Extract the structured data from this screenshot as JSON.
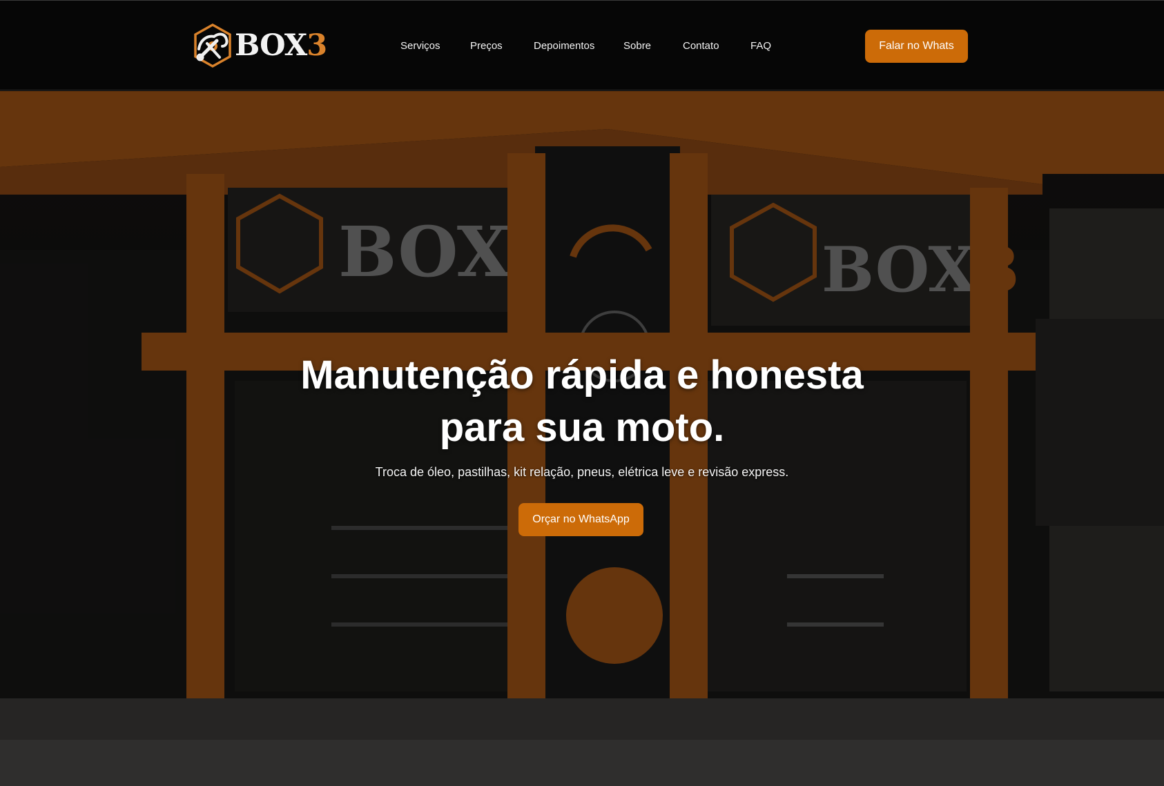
{
  "header": {
    "logo": {
      "text_main": "BOX",
      "text_accent": "3"
    },
    "nav": [
      {
        "label": "Serviços"
      },
      {
        "label": "Preços"
      },
      {
        "label": "Depoimentos"
      },
      {
        "label": "Sobre"
      },
      {
        "label": "Contato"
      },
      {
        "label": "FAQ"
      }
    ],
    "cta_label": "Falar no Whats"
  },
  "hero": {
    "title_line1": "Manutenção rápida e honesta",
    "title_line2": "para sua moto.",
    "subtitle": "Troca de óleo, pastilhas, kit relação, pneus, elétrica leve e revisão express.",
    "cta_label": "Orçar no WhatsApp",
    "background_image": "moto-shop-storefront-photo"
  },
  "colors": {
    "accent": "#cc6b08",
    "logo_orange": "#d9822b",
    "header_bg": "#060606"
  }
}
